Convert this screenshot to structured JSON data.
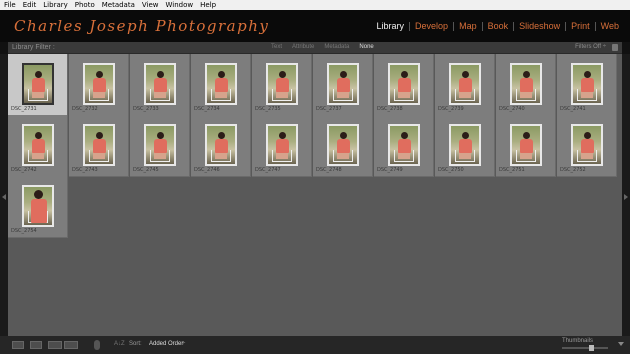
{
  "menu": [
    "File",
    "Edit",
    "Library",
    "Photo",
    "Metadata",
    "View",
    "Window",
    "Help"
  ],
  "brand": "Charles Joseph Photography",
  "modules": [
    {
      "label": "Library",
      "active": true
    },
    {
      "label": "Develop",
      "active": false
    },
    {
      "label": "Map",
      "active": false
    },
    {
      "label": "Book",
      "active": false
    },
    {
      "label": "Slideshow",
      "active": false
    },
    {
      "label": "Print",
      "active": false
    },
    {
      "label": "Web",
      "active": false
    }
  ],
  "filter": {
    "title": "Library Filter :",
    "options": [
      {
        "label": "Text",
        "active": false
      },
      {
        "label": "Attribute",
        "active": false
      },
      {
        "label": "Metadata",
        "active": false
      },
      {
        "label": "None",
        "active": true
      }
    ],
    "filters_off": "Filters Off ÷"
  },
  "photos": [
    {
      "name": "DSC_2731",
      "selected": true,
      "close": false
    },
    {
      "name": "DSC_2732",
      "selected": false,
      "close": false
    },
    {
      "name": "DSC_2733",
      "selected": false,
      "close": false
    },
    {
      "name": "DSC_2734",
      "selected": false,
      "close": false
    },
    {
      "name": "DSC_2735",
      "selected": false,
      "close": false
    },
    {
      "name": "DSC_2737",
      "selected": false,
      "close": false
    },
    {
      "name": "DSC_2738",
      "selected": false,
      "close": false
    },
    {
      "name": "DSC_2739",
      "selected": false,
      "close": false
    },
    {
      "name": "DSC_2740",
      "selected": false,
      "close": false
    },
    {
      "name": "DSC_2741",
      "selected": false,
      "close": false
    },
    {
      "name": "DSC_2742",
      "selected": false,
      "close": false
    },
    {
      "name": "DSC_2743",
      "selected": false,
      "close": false
    },
    {
      "name": "DSC_2745",
      "selected": false,
      "close": false
    },
    {
      "name": "DSC_2746",
      "selected": false,
      "close": false
    },
    {
      "name": "DSC_2747",
      "selected": false,
      "close": false
    },
    {
      "name": "DSC_2748",
      "selected": false,
      "close": false
    },
    {
      "name": "DSC_2749",
      "selected": false,
      "close": false
    },
    {
      "name": "DSC_2750",
      "selected": false,
      "close": false
    },
    {
      "name": "DSC_2751",
      "selected": false,
      "close": false
    },
    {
      "name": "DSC_2752",
      "selected": false,
      "close": false
    },
    {
      "name": "DSC_2754",
      "selected": false,
      "close": true
    }
  ],
  "toolbar": {
    "az": "A↓Z",
    "sort_label": "Sort:",
    "sort_value": "Added Order",
    "sort_chevron": "÷",
    "thumbnails_label": "Thumbnails",
    "thumbnail_size": 0.62
  },
  "colors": {
    "accent": "#d9703a",
    "grid_bg": "#595959",
    "cell_bg": "#7d7d7d",
    "cell_selected": "#c8c8c8"
  }
}
